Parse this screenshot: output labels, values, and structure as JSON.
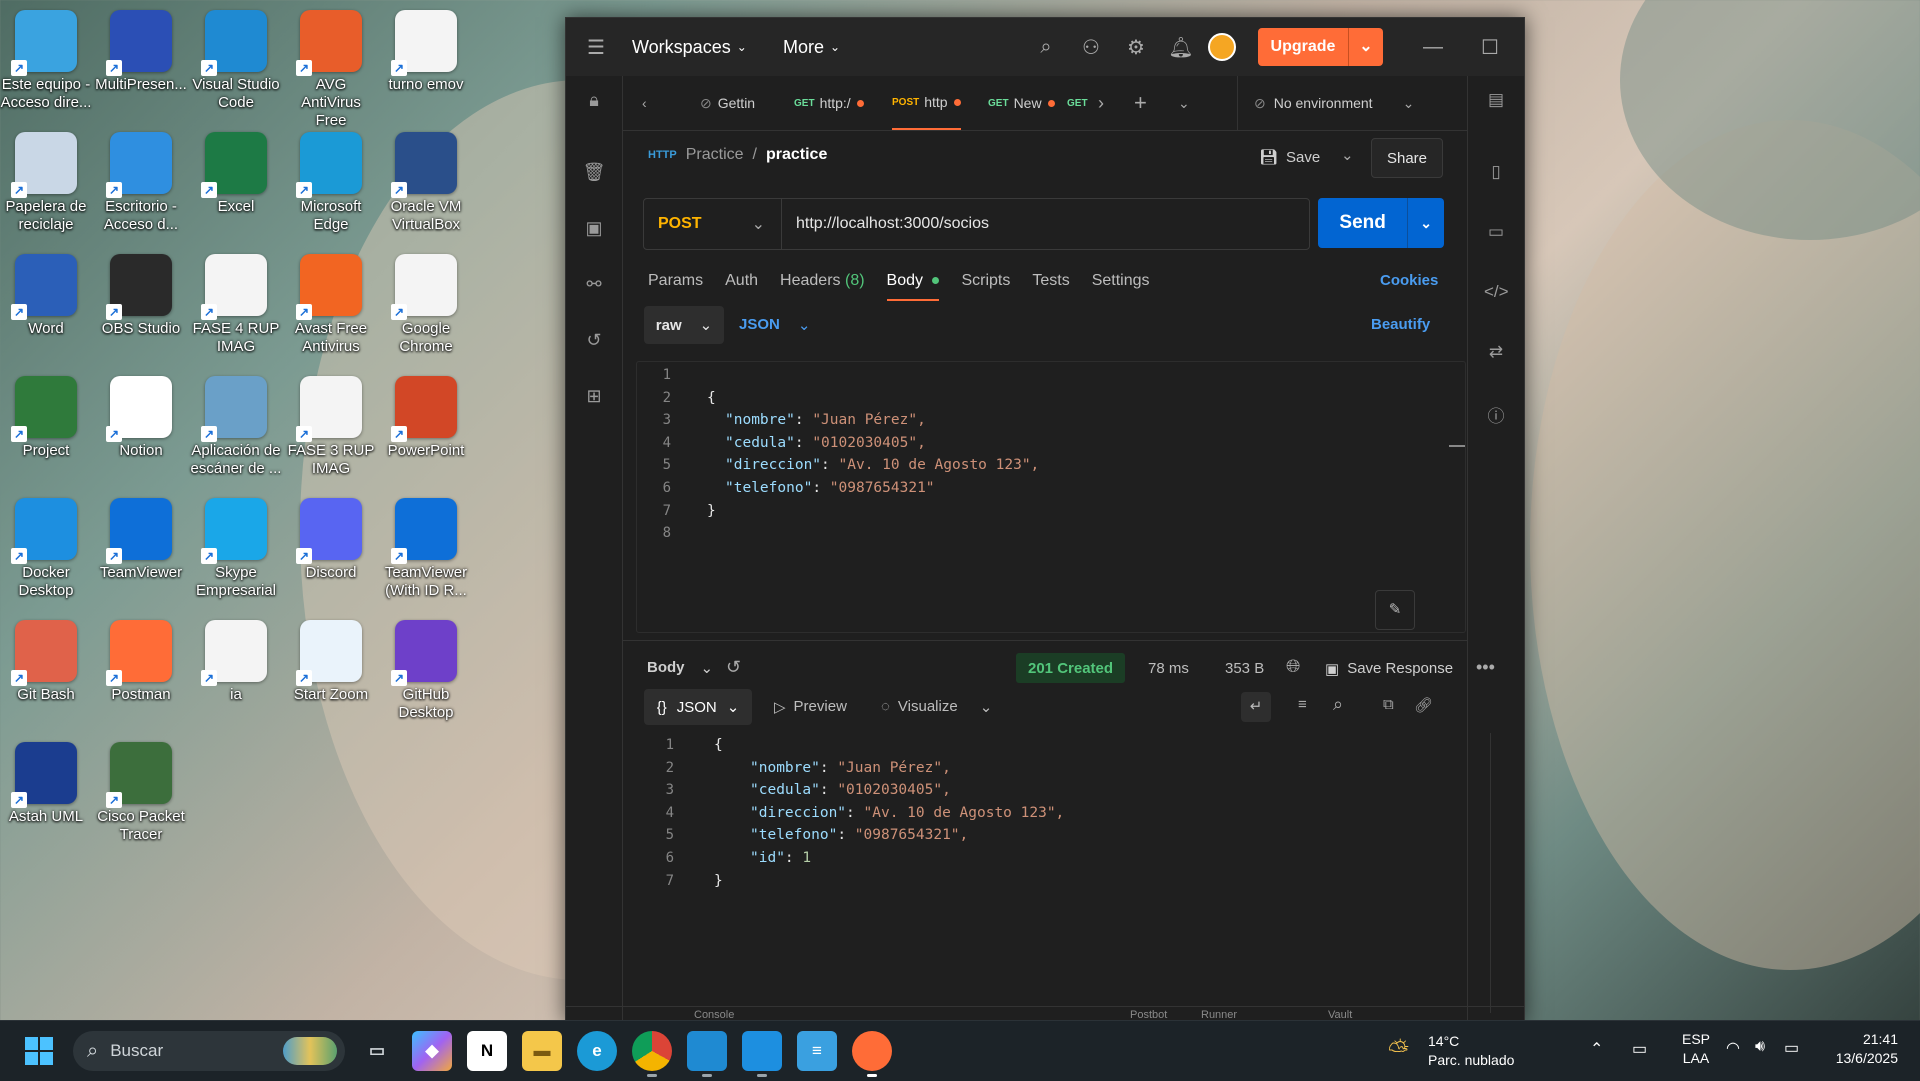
{
  "desktop": {
    "icons": [
      {
        "label": "Este equipo - Acceso dire...",
        "icon": "computer-icon",
        "color": "#3aa3e0"
      },
      {
        "label": "MultiPresen...",
        "icon": "multipresenter-icon",
        "color": "#2b4fb5"
      },
      {
        "label": "Visual Studio Code",
        "icon": "vscode-icon",
        "color": "#1f8ad2"
      },
      {
        "label": "AVG AntiVirus Free",
        "icon": "avg-icon",
        "color": "#e85d2a"
      },
      {
        "label": "turno emov",
        "icon": "chrome-icon",
        "color": "#f4f4f4"
      },
      {
        "label": "Papelera de reciclaje",
        "icon": "recycle-bin-icon",
        "color": "#c9d7e6"
      },
      {
        "label": "Escritorio - Acceso d...",
        "icon": "desktop-folder-icon",
        "color": "#2f8fe0"
      },
      {
        "label": "Excel",
        "icon": "excel-icon",
        "color": "#1d7a45"
      },
      {
        "label": "Microsoft Edge",
        "icon": "edge-icon",
        "color": "#1b9ad6"
      },
      {
        "label": "Oracle VM VirtualBox",
        "icon": "virtualbox-icon",
        "color": "#2a4f8a"
      },
      {
        "label": "Word",
        "icon": "word-icon",
        "color": "#2b5fb8"
      },
      {
        "label": "OBS Studio",
        "icon": "obs-icon",
        "color": "#2a2a2a"
      },
      {
        "label": "FASE 4 RUP IMAG",
        "icon": "chrome-icon",
        "color": "#f4f4f4"
      },
      {
        "label": "Avast Free Antivirus",
        "icon": "avast-icon",
        "color": "#f26522"
      },
      {
        "label": "Google Chrome",
        "icon": "chrome-icon",
        "color": "#f4f4f4"
      },
      {
        "label": "Project",
        "icon": "project-icon",
        "color": "#2f7a3b"
      },
      {
        "label": "Notion",
        "icon": "notion-icon",
        "color": "#ffffff"
      },
      {
        "label": "Aplicación de escáner de ...",
        "icon": "scanner-icon",
        "color": "#6aa0c8"
      },
      {
        "label": "FASE 3 RUP IMAG",
        "icon": "chrome-icon",
        "color": "#f4f4f4"
      },
      {
        "label": "PowerPoint",
        "icon": "powerpoint-icon",
        "color": "#d24726"
      },
      {
        "label": "Docker Desktop",
        "icon": "docker-icon",
        "color": "#1d8fe0"
      },
      {
        "label": "TeamViewer",
        "icon": "teamviewer-icon",
        "color": "#0e6fd8"
      },
      {
        "label": "Skype Empresarial",
        "icon": "skype-icon",
        "color": "#1aa7e8"
      },
      {
        "label": "Discord",
        "icon": "discord-icon",
        "color": "#5865f2"
      },
      {
        "label": "TeamViewer (With ID R...",
        "icon": "teamviewer-icon",
        "color": "#0e6fd8"
      },
      {
        "label": "Git Bash",
        "icon": "git-bash-icon",
        "color": "#e0624a"
      },
      {
        "label": "Postman",
        "icon": "postman-icon",
        "color": "#ff6c37"
      },
      {
        "label": "ia",
        "icon": "chrome-profile-icon",
        "color": "#f4f4f4"
      },
      {
        "label": "Start Zoom",
        "icon": "zoom-icon",
        "color": "#eaf3fb"
      },
      {
        "label": "GitHub Desktop",
        "icon": "github-desktop-icon",
        "color": "#6e40c9"
      },
      {
        "label": "Astah UML",
        "icon": "astah-icon",
        "color": "#1b3d8f"
      },
      {
        "label": "Cisco Packet Tracer",
        "icon": "packet-tracer-icon",
        "color": "#3c6e3c"
      }
    ]
  },
  "postman": {
    "title_bar": {
      "workspaces": "Workspaces",
      "more": "More",
      "upgrade": "Upgrade"
    },
    "tabs": [
      {
        "method": "",
        "label": "Gettin",
        "dot": false
      },
      {
        "method": "GET",
        "label": "http:/",
        "dot": true
      },
      {
        "method": "POST",
        "label": "http",
        "dot": true
      },
      {
        "method": "GET",
        "label": "New",
        "dot": true
      },
      {
        "method": "GET",
        "label": "",
        "dot": false
      }
    ],
    "environment": "No environment",
    "breadcrumb": {
      "collection": "Practice",
      "separator": "/",
      "request": "practice"
    },
    "save": "Save",
    "share": "Share",
    "method": "POST",
    "url": "http://localhost:3000/socios",
    "send": "Send",
    "request_tabs": {
      "params": "Params",
      "auth": "Auth",
      "headers": "Headers",
      "headers_count": "(8)",
      "body": "Body",
      "scripts": "Scripts",
      "tests": "Tests",
      "settings": "Settings"
    },
    "cookies": "Cookies",
    "body_mode": "raw",
    "body_format": "JSON",
    "beautify": "Beautify",
    "request_body_lines": [
      {
        "n": "1",
        "text": ""
      },
      {
        "n": "2",
        "text": "{"
      },
      {
        "n": "3",
        "key": "\"nombre\"",
        "value": "\"Juan Pérez\","
      },
      {
        "n": "4",
        "key": "\"cedula\"",
        "value": "\"0102030405\","
      },
      {
        "n": "5",
        "key": "\"direccion\"",
        "value": "\"Av. 10 de Agosto 123\","
      },
      {
        "n": "6",
        "key": "\"telefono\"",
        "value": "\"0987654321\""
      },
      {
        "n": "7",
        "text": "}"
      },
      {
        "n": "8",
        "text": ""
      }
    ],
    "response": {
      "body_label": "Body",
      "status": "201 Created",
      "time": "78 ms",
      "size": "353 B",
      "save_response": "Save Response",
      "format": "JSON",
      "preview": "Preview",
      "visualize": "Visualize",
      "lines": [
        {
          "n": "1",
          "text": "{"
        },
        {
          "n": "2",
          "key": "\"nombre\"",
          "value": "\"Juan Pérez\","
        },
        {
          "n": "3",
          "key": "\"cedula\"",
          "value": "\"0102030405\","
        },
        {
          "n": "4",
          "key": "\"direccion\"",
          "value": "\"Av. 10 de Agosto 123\","
        },
        {
          "n": "5",
          "key": "\"telefono\"",
          "value": "\"0987654321\","
        },
        {
          "n": "6",
          "key": "\"id\"",
          "value": "1",
          "numeric": true
        },
        {
          "n": "7",
          "text": "}"
        }
      ]
    },
    "status_bar": {
      "console": "Console",
      "postbot": "Postbot",
      "runner": "Runner",
      "vault": "Vault"
    }
  },
  "taskbar": {
    "search_placeholder": "Buscar",
    "weather_temp": "14°C",
    "weather_desc": "Parc. nublado",
    "lang_top": "ESP",
    "lang_bottom": "LAA",
    "time": "21:41",
    "date": "13/6/2025"
  }
}
